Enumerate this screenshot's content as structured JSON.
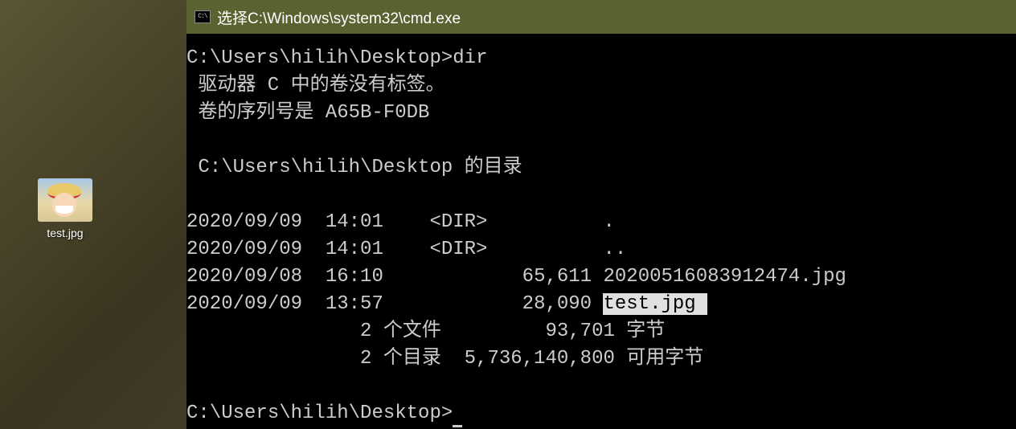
{
  "desktop": {
    "icon_label": "test.jpg"
  },
  "window": {
    "title": "选择C:\\Windows\\system32\\cmd.exe"
  },
  "terminal": {
    "prompt1": "C:\\Users\\hilih\\Desktop>",
    "command1": "dir",
    "volume_line": " 驱动器 C 中的卷没有标签。",
    "serial_line": " 卷的序列号是 A65B-F0DB",
    "dirof_line": " C:\\Users\\hilih\\Desktop 的目录",
    "entries": [
      "2020/09/09  14:01    <DIR>          .",
      "2020/09/09  14:01    <DIR>          ..",
      "2020/09/08  16:10            65,611 20200516083912474.jpg"
    ],
    "entry_sel_prefix": "2020/09/09  13:57            28,090 ",
    "entry_sel_name": "test.jpg ",
    "summary_files": "               2 个文件         93,701 字节",
    "summary_dirs": "               2 个目录  5,736,140,800 可用字节",
    "prompt2": "C:\\Users\\hilih\\Desktop>"
  }
}
